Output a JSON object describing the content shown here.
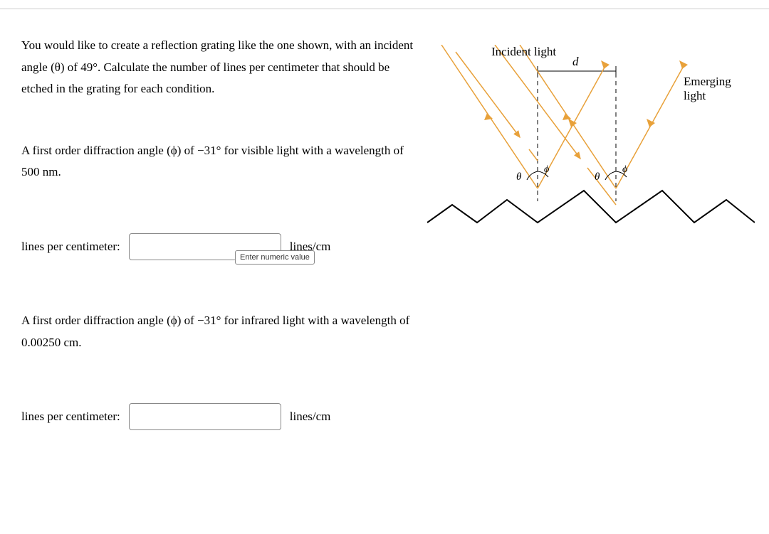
{
  "intro": "You would like to create a reflection grating like the one shown, with an incident angle (θ) of 49°. Calculate the number of lines per centimeter that should be etched in the grating for each condition.",
  "condition1": "A first order diffraction angle (ϕ) of −31° for visible light with a wavelength of 500 nm.",
  "condition2": "A first order diffraction angle (ϕ) of −31° for infrared light with a wavelength of 0.00250 cm.",
  "answer_label": "lines per centimeter:",
  "unit_label": "lines/cm",
  "tooltip": "Enter numeric value",
  "figure": {
    "incident_label": "Incident light",
    "emerging_label": "Emerging light",
    "d_label": "d",
    "theta_label": "θ",
    "phi_label": "ϕ"
  }
}
